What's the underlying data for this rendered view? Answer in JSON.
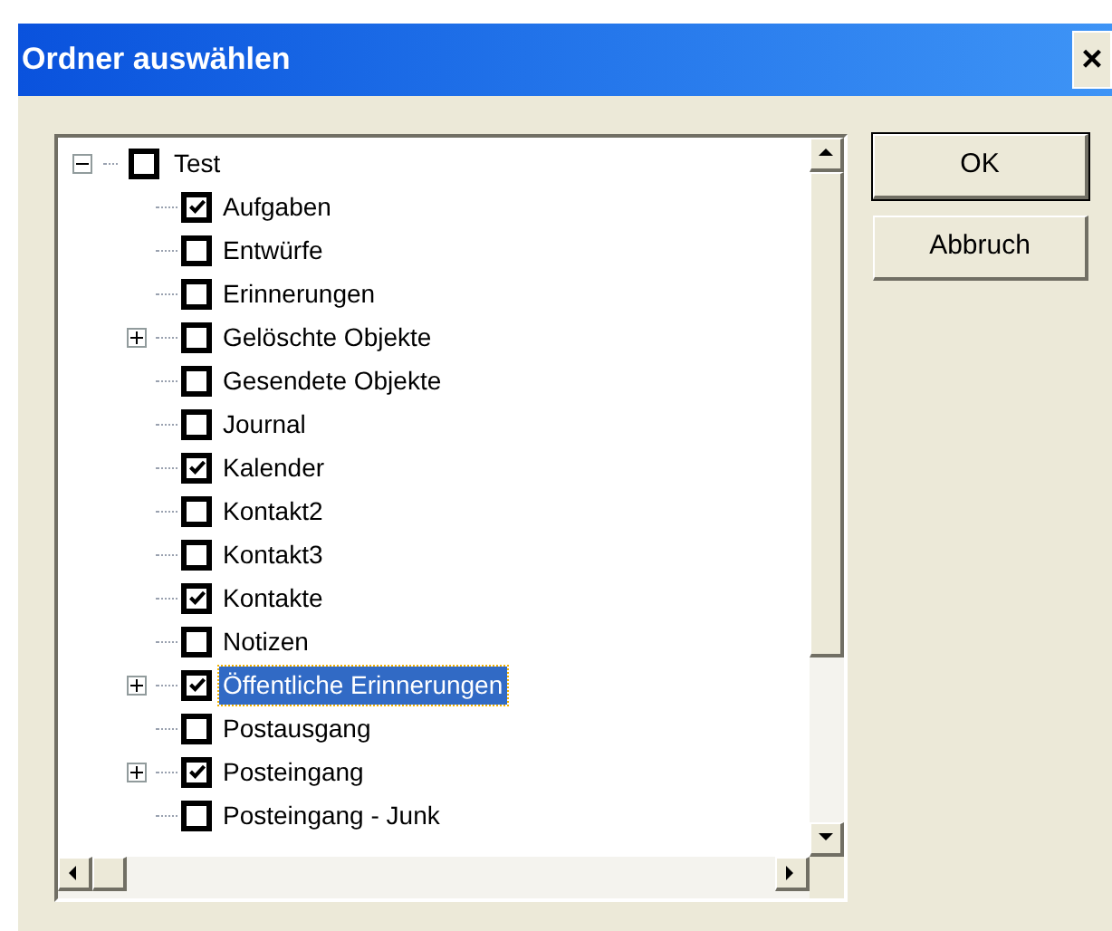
{
  "window": {
    "title": "Ordner auswählen",
    "close": "×"
  },
  "tree": {
    "label": "Test",
    "checked": false,
    "expanded": true,
    "children": [
      {
        "label": "Aufgaben",
        "checked": true,
        "expandable": false,
        "selected": false
      },
      {
        "label": "Entwürfe",
        "checked": false,
        "expandable": false,
        "selected": false
      },
      {
        "label": "Erinnerungen",
        "checked": false,
        "expandable": false,
        "selected": false
      },
      {
        "label": "Gelöschte Objekte",
        "checked": false,
        "expandable": true,
        "selected": false
      },
      {
        "label": "Gesendete Objekte",
        "checked": false,
        "expandable": false,
        "selected": false
      },
      {
        "label": "Journal",
        "checked": false,
        "expandable": false,
        "selected": false
      },
      {
        "label": "Kalender",
        "checked": true,
        "expandable": false,
        "selected": false
      },
      {
        "label": "Kontakt2",
        "checked": false,
        "expandable": false,
        "selected": false
      },
      {
        "label": "Kontakt3",
        "checked": false,
        "expandable": false,
        "selected": false
      },
      {
        "label": "Kontakte",
        "checked": true,
        "expandable": false,
        "selected": false
      },
      {
        "label": "Notizen",
        "checked": false,
        "expandable": false,
        "selected": false
      },
      {
        "label": "Öffentliche Erinnerungen",
        "checked": true,
        "expandable": true,
        "selected": true
      },
      {
        "label": "Postausgang",
        "checked": false,
        "expandable": false,
        "selected": false
      },
      {
        "label": "Posteingang",
        "checked": true,
        "expandable": true,
        "selected": false
      },
      {
        "label": "Posteingang - Junk",
        "checked": false,
        "expandable": false,
        "selected": false
      }
    ]
  },
  "buttons": [
    {
      "label": "OK",
      "default": true
    },
    {
      "label": "Abbruch",
      "default": false
    }
  ]
}
